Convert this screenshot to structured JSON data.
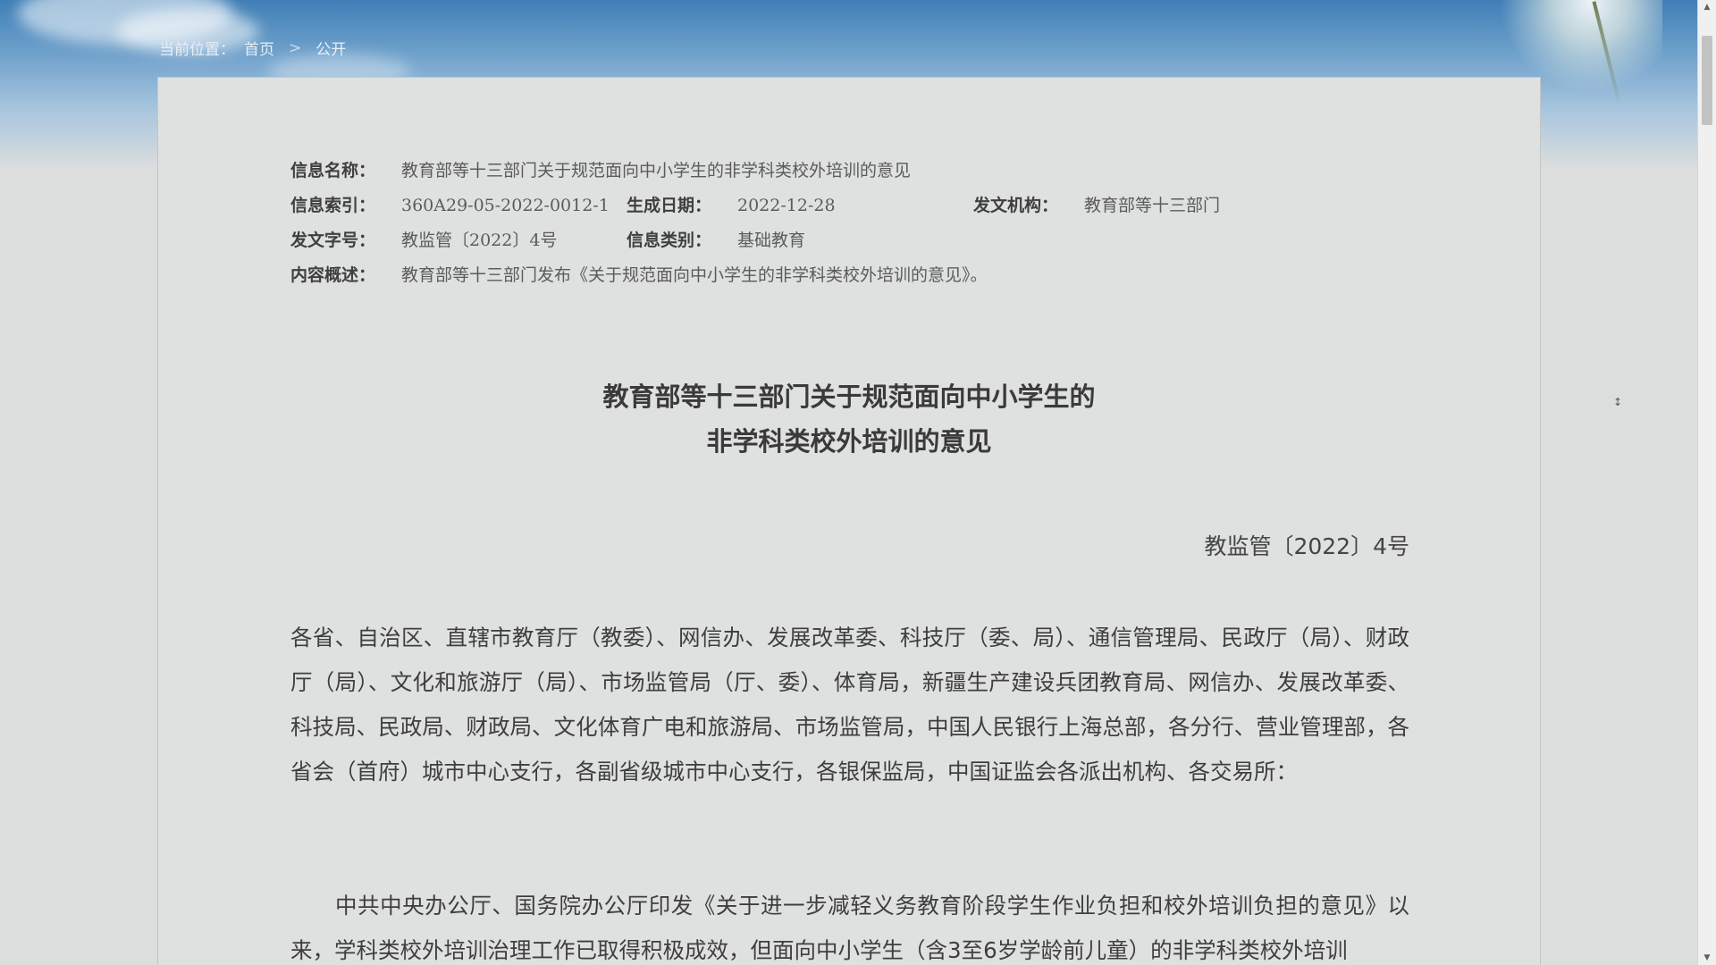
{
  "breadcrumb": {
    "prefix": "当前位置：",
    "home": "首页",
    "separator": ">",
    "current": "公开"
  },
  "meta": {
    "name_label": "信息名称：",
    "name_value": "教育部等十三部门关于规范面向中小学生的非学科类校外培训的意见",
    "index_label": "信息索引：",
    "index_value": "360A29-05-2022-0012-1",
    "date_label": "生成日期：",
    "date_value": "2022-12-28",
    "issuer_label": "发文机构：",
    "issuer_value": "教育部等十三部门",
    "docno_label": "发文字号：",
    "docno_value": "教监管〔2022〕4号",
    "category_label": "信息类别：",
    "category_value": "基础教育",
    "summary_label": "内容概述：",
    "summary_value": "教育部等十三部门发布《关于规范面向中小学生的非学科类校外培训的意见》。"
  },
  "document": {
    "title_line1": "教育部等十三部门关于规范面向中小学生的",
    "title_line2": "非学科类校外培训的意见",
    "number": "教监管〔2022〕4号",
    "paragraph1": "各省、自治区、直辖市教育厅（教委）、网信办、发展改革委、科技厅（委、局）、通信管理局、民政厅（局）、财政厅（局）、文化和旅游厅（局）、市场监管局（厅、委）、体育局，新疆生产建设兵团教育局、网信办、发展改革委、科技局、民政局、财政局、文化体育广电和旅游局、市场监管局，中国人民银行上海总部，各分行、营业管理部，各省会（首府）城市中心支行，各副省级城市中心支行，各银保监局，中国证监会各派出机构、各交易所：",
    "paragraph2": "中共中央办公厅、国务院办公厅印发《关于进一步减轻义务教育阶段学生作业负担和校外培训负担的意见》以来，学科类校外培训治理工作已取得积极成效，但面向中小学生（含3至6岁学龄前儿童）的非学科类校外培训"
  },
  "scrollbar": {
    "up_icon": "▲",
    "down_icon": "▼"
  },
  "side": {
    "arrows": "↕"
  }
}
